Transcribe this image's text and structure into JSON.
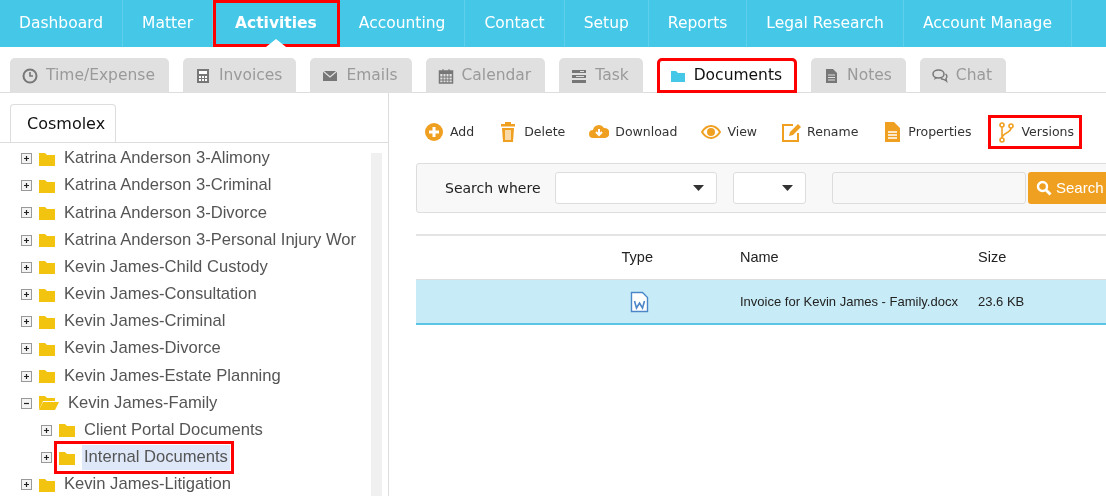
{
  "nav": [
    {
      "label": "Dashboard",
      "selected": false,
      "highlighted": false
    },
    {
      "label": "Matter",
      "selected": false,
      "highlighted": false
    },
    {
      "label": "Activities",
      "selected": true,
      "highlighted": true
    },
    {
      "label": "Accounting",
      "selected": false,
      "highlighted": false
    },
    {
      "label": "Contact",
      "selected": false,
      "highlighted": false
    },
    {
      "label": "Setup",
      "selected": false,
      "highlighted": false
    },
    {
      "label": "Reports",
      "selected": false,
      "highlighted": false
    },
    {
      "label": "Legal Research",
      "selected": false,
      "highlighted": false
    },
    {
      "label": "Account Manage",
      "selected": false,
      "highlighted": false
    }
  ],
  "subtabs": [
    {
      "label": "Time/Expense",
      "selected": false,
      "highlighted": false
    },
    {
      "label": "Invoices",
      "selected": false,
      "highlighted": false
    },
    {
      "label": "Emails",
      "selected": false,
      "highlighted": false
    },
    {
      "label": "Calendar",
      "selected": false,
      "highlighted": false
    },
    {
      "label": "Task",
      "selected": false,
      "highlighted": false
    },
    {
      "label": "Documents",
      "selected": true,
      "highlighted": true
    },
    {
      "label": "Notes",
      "selected": false,
      "highlighted": false
    },
    {
      "label": "Chat",
      "selected": false,
      "highlighted": false
    }
  ],
  "tree_tab": {
    "label": "Cosmolex",
    "selected": true
  },
  "tree": [
    {
      "label": "Katrina Anderson 3-Alimony",
      "expanded": false,
      "selected": false,
      "highlighted": false
    },
    {
      "label": "Katrina Anderson 3-Criminal",
      "expanded": false,
      "selected": false,
      "highlighted": false
    },
    {
      "label": "Katrina Anderson 3-Divorce",
      "expanded": false,
      "selected": false,
      "highlighted": false
    },
    {
      "label": "Katrina Anderson 3-Personal Injury Wor",
      "expanded": false,
      "selected": false,
      "highlighted": false
    },
    {
      "label": "Kevin James-Child Custody",
      "expanded": false,
      "selected": false,
      "highlighted": false
    },
    {
      "label": "Kevin James-Consultation",
      "expanded": false,
      "selected": false,
      "highlighted": false
    },
    {
      "label": "Kevin James-Criminal",
      "expanded": false,
      "selected": false,
      "highlighted": false
    },
    {
      "label": "Kevin James-Divorce",
      "expanded": false,
      "selected": false,
      "highlighted": false
    },
    {
      "label": "Kevin James-Estate Planning",
      "expanded": false,
      "selected": false,
      "highlighted": false
    },
    {
      "label": "Kevin James-Family",
      "expanded": true,
      "selected": false,
      "highlighted": false,
      "children": [
        {
          "label": "Client Portal Documents",
          "expanded": false,
          "selected": false,
          "highlighted": false
        },
        {
          "label": "Internal Documents",
          "expanded": false,
          "selected": true,
          "highlighted": true
        }
      ]
    },
    {
      "label": "Kevin James-Litigation",
      "expanded": false,
      "selected": false,
      "highlighted": false
    }
  ],
  "toolbar": [
    {
      "label": "Add",
      "highlighted": false
    },
    {
      "label": "Delete",
      "highlighted": false
    },
    {
      "label": "Download",
      "highlighted": false
    },
    {
      "label": "View",
      "highlighted": false
    },
    {
      "label": "Rename",
      "highlighted": false
    },
    {
      "label": "Properties",
      "highlighted": false
    },
    {
      "label": "Versions",
      "highlighted": true
    }
  ],
  "search": {
    "label": "Search where",
    "button": "Search"
  },
  "table": {
    "columns": [
      "Type",
      "Name",
      "Size"
    ],
    "rows": [
      {
        "name": "Invoice for Kevin James - Family.docx",
        "size": "23.6 KB",
        "selected": true
      }
    ]
  }
}
